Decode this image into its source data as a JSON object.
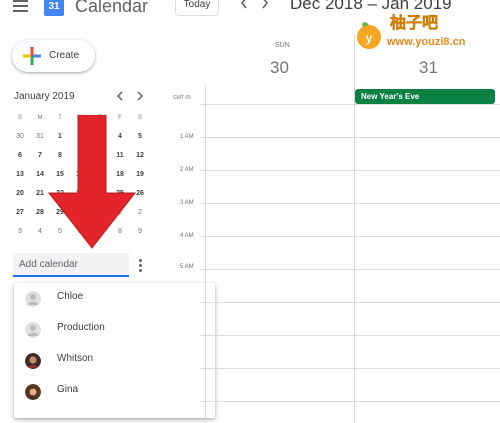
{
  "header": {
    "menu_icon": "hamburger-menu-icon",
    "logo_day": "31",
    "app_title": "Calendar",
    "today_label": "Today",
    "prev_icon": "chevron-left-icon",
    "next_icon": "chevron-right-icon",
    "date_range": "Dec 2018 – Jan 2019"
  },
  "watermark": {
    "title": "柚子吧",
    "url": "www.youzi8.cn"
  },
  "create": {
    "label": "Create",
    "icon": "colorful-plus-icon"
  },
  "mini_calendar": {
    "title": "January 2019",
    "weekdays": [
      "S",
      "M",
      "T",
      "W",
      "T",
      "F",
      "S"
    ],
    "weeks": [
      [
        "30",
        "31",
        "1",
        "2",
        "3",
        "4",
        "5"
      ],
      [
        "6",
        "7",
        "8",
        "9",
        "10",
        "11",
        "12"
      ],
      [
        "13",
        "14",
        "15",
        "16",
        "17",
        "18",
        "19"
      ],
      [
        "20",
        "21",
        "22",
        "23",
        "24",
        "25",
        "26"
      ],
      [
        "27",
        "28",
        "29",
        "30",
        "31",
        "1",
        "2"
      ],
      [
        "3",
        "4",
        "5",
        "6",
        "7",
        "8",
        "9"
      ]
    ]
  },
  "add_calendar": {
    "placeholder": "Add calendar",
    "more_icon": "more-vert-icon"
  },
  "suggestions": [
    {
      "name": "Chloe",
      "avatar": "default-avatar-icon"
    },
    {
      "name": "Production",
      "avatar": "default-avatar-icon"
    },
    {
      "name": "Whitson",
      "avatar": "photo-avatar"
    },
    {
      "name": "Gina",
      "avatar": "photo-avatar"
    }
  ],
  "grid": {
    "tz": "GMT-05",
    "days": [
      {
        "dow": "SUN",
        "num": "30"
      },
      {
        "dow": "",
        "num": "31"
      }
    ],
    "event": "New Year's Eve",
    "times": [
      "1 AM",
      "2 AM",
      "3 AM",
      "4 AM",
      "5 AM"
    ]
  },
  "colors": {
    "event_green": "#0b8043",
    "focus_blue": "#1a73e8",
    "arrow_red": "#e3242b",
    "watermark_orange": "#f5a623"
  }
}
